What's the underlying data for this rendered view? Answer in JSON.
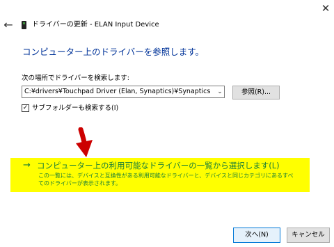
{
  "window": {
    "title": "ドライバーの更新 - ELAN Input Device",
    "back_icon": "←",
    "close_icon": "✕"
  },
  "heading": "コンピューター上のドライバーを参照します。",
  "search": {
    "label": "次の場所でドライバーを検索します:",
    "path_value": "C:¥drivers¥Touchpad Driver (Elan, Synaptics)¥Synaptics",
    "dropdown_icon": "⌄",
    "browse_label": "参照(R)..."
  },
  "subfolder": {
    "checked_glyph": "✓",
    "label": "サブフォルダーも検索する(I)"
  },
  "pick_option": {
    "arrow": "→",
    "title": "コンピューター上の利用可能なドライバーの一覧から選択します(L)",
    "description": "この一覧には、デバイスと互換性がある利用可能なドライバーと、デバイスと同じカテゴリにあるすべてのドライバーが表示されます。"
  },
  "colors": {
    "heading": "#003399",
    "link": "#1a7f37",
    "highlight": "#ffff00",
    "annotation_arrow": "#cc0000"
  },
  "footer": {
    "next_label": "次へ(N)",
    "cancel_label": "キャンセル"
  }
}
